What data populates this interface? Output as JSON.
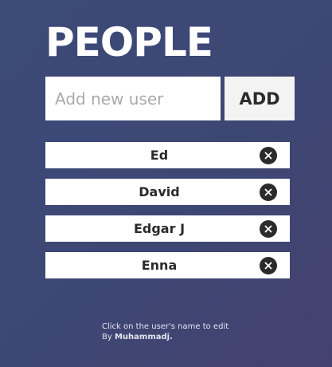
{
  "header": {
    "title": "PEOPLE"
  },
  "add_form": {
    "placeholder": "Add new user",
    "value": "",
    "button_label": "ADD"
  },
  "users": [
    {
      "name": "Ed",
      "remove_icon": "close-icon"
    },
    {
      "name": "David",
      "remove_icon": "close-icon"
    },
    {
      "name": "Edgar J",
      "remove_icon": "close-icon"
    },
    {
      "name": "Enna",
      "remove_icon": "close-icon"
    }
  ],
  "footer": {
    "hint": "Click on the user's name to edit",
    "by_prefix": "By ",
    "author": "Muhammadj."
  },
  "colors": {
    "background": "#3d4774",
    "text_light": "#ffffff",
    "item_background": "#ffffff",
    "text_dark": "#2b2b2b"
  }
}
